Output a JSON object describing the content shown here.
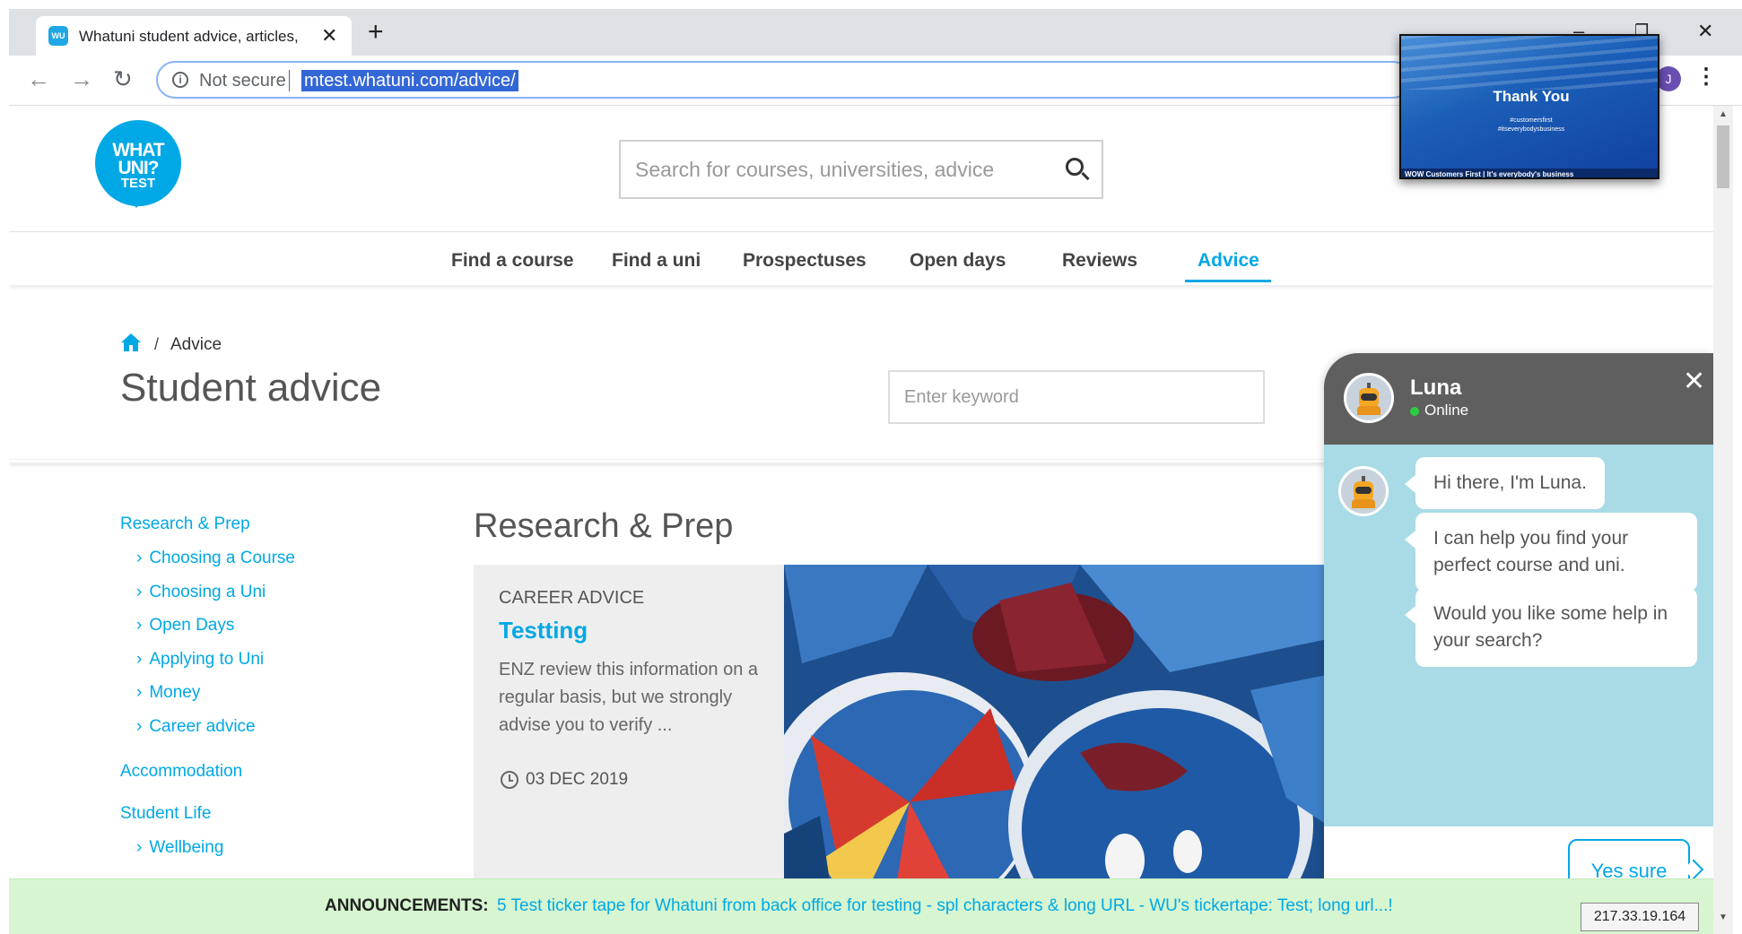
{
  "browser": {
    "tab_title": "Whatuni student advice, articles,",
    "favicon_text": "WU",
    "new_tab_icon": "plus-icon",
    "not_secure": "Not secure",
    "url": "mtest.whatuni.com/advice/",
    "profile_initial": "J"
  },
  "pip": {
    "title": "Thank You",
    "tag1": "#customersfirst",
    "tag2": "#itseverybodysbusiness",
    "ticker": "WOW  Customers First | It's everybody's business"
  },
  "site": {
    "logo_line1": "WHAT",
    "logo_line2": "UNI?",
    "logo_line3": "TEST",
    "search_placeholder": "Search for courses, universities, advice",
    "nav": [
      "Find a course",
      "Find a uni",
      "Prospectuses",
      "Open days",
      "Reviews",
      "Advice"
    ],
    "accent_color": "#00a8e6"
  },
  "page": {
    "breadcrumb_current": "Advice",
    "title": "Student advice",
    "keyword_placeholder": "Enter keyword",
    "section_title": "Research & Prep"
  },
  "sidebar": {
    "group1": "Research & Prep",
    "group1_items": [
      "Choosing a Course",
      "Choosing a Uni",
      "Open Days",
      "Applying to Uni",
      "Money",
      "Career advice"
    ],
    "group2": "Accommodation",
    "group3": "Student Life",
    "group3_items": [
      "Wellbeing"
    ]
  },
  "card": {
    "category": "CAREER ADVICE",
    "title": "Testting",
    "description": "ENZ review this information on a regular basis, but we strongly advise you to verify ...",
    "date": "03 DEC 2019"
  },
  "chat": {
    "name": "Luna",
    "status": "Online",
    "messages": [
      "Hi there, I'm Luna.",
      "I can help you find your perfect course and uni.",
      "Would you like some help in your search?"
    ],
    "reply_button": "Yes sure"
  },
  "ticker": {
    "label": "ANNOUNCEMENTS:",
    "text": "5 Test ticker tape for Whatuni from back office for testing - spl characters & long URL - WU's tickertape: Test; long url...!"
  },
  "ip_address": "217.33.19.164"
}
